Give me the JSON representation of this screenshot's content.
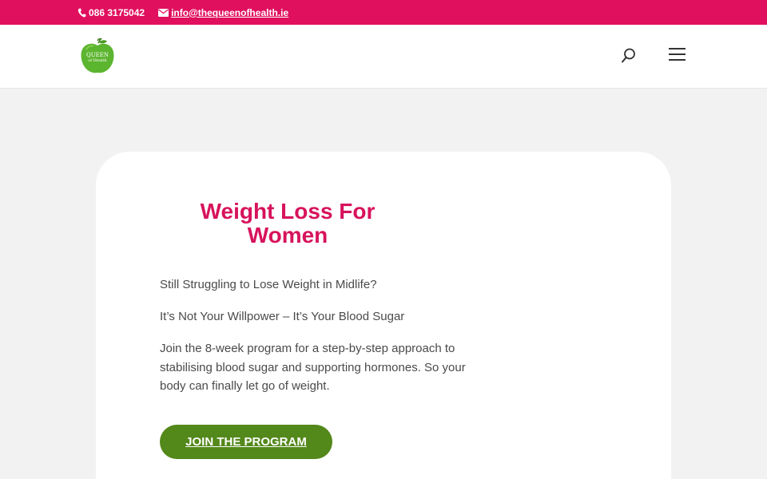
{
  "topbar": {
    "phone": "086 3175042",
    "email": "info@thequeenofhealth.ie",
    "background": "#e0105e"
  },
  "header": {
    "logo": {
      "line1": "QUEEN",
      "line2": "of Health",
      "icon": "green-apple-logo"
    },
    "search_icon": "search-icon",
    "menu_icon": "hamburger-menu-icon"
  },
  "hero": {
    "title": "Weight Loss For Women",
    "paragraphs": [
      "Still Struggling to Lose Weight in Midlife?",
      "It’s Not Your Willpower – It’s Your Blood Sugar",
      "Join the 8-week program for a step-by-step approach to stabilising blood sugar and supporting hormones. So your body can finally let go of weight."
    ],
    "cta_label": "JOIN THE PROGRAM"
  },
  "colors": {
    "accent_pink": "#d7135c",
    "button_green": "#53881a",
    "logo_green": "#5cb52f"
  }
}
